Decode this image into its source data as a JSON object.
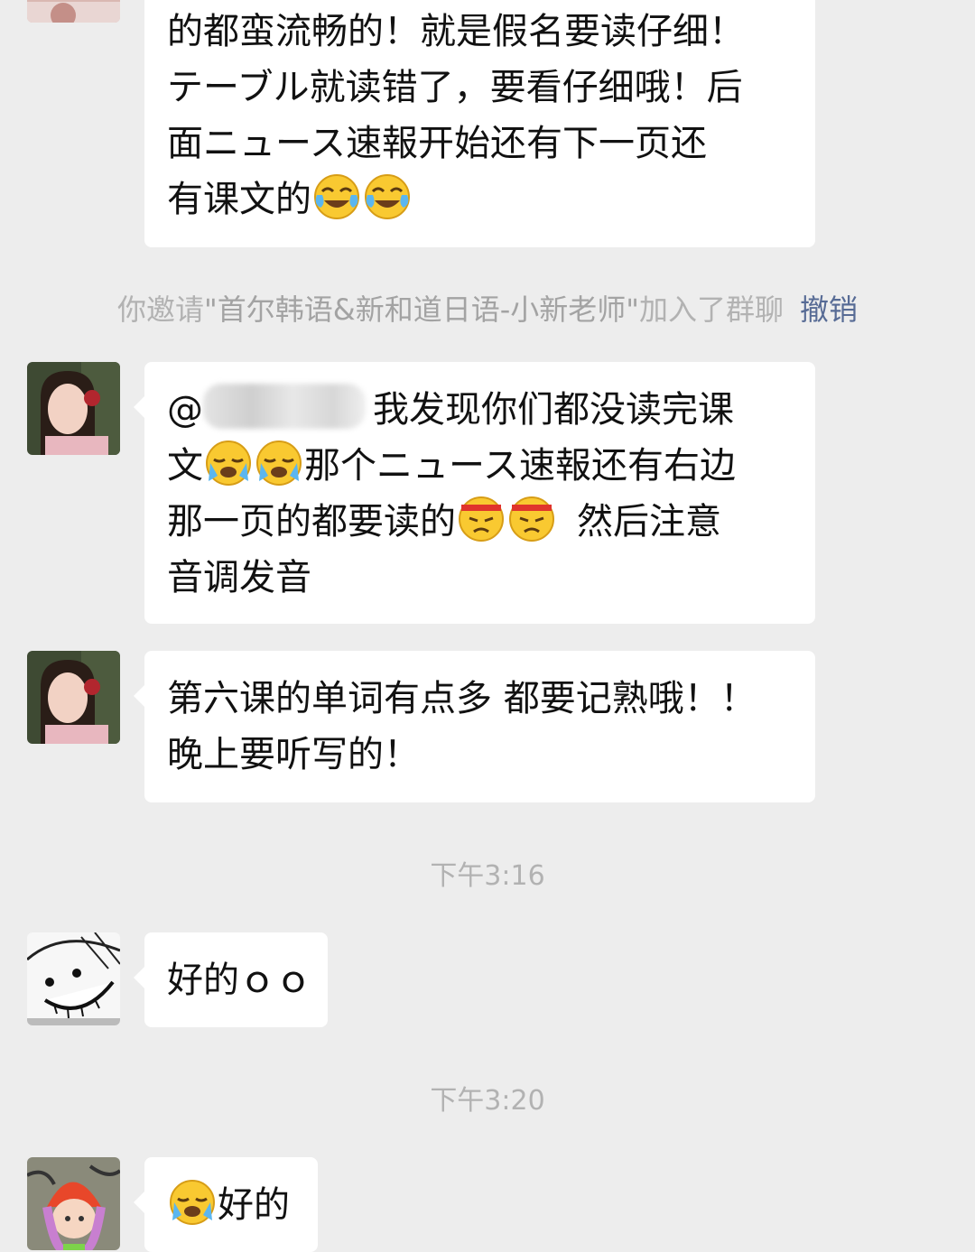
{
  "messages": {
    "m1": {
      "lines": [
        "的都蛮流畅的！就是假名要读仔细！",
        "テーブル就读错了，要看仔细哦！后",
        "面ニュース速報开始还有下一页还",
        "有课文的"
      ],
      "emoji": "tears-of-joy-emoji"
    },
    "system": {
      "prefix": "你邀请",
      "name": "\"首尔韩语&新和道日语-小新老师\"",
      "suffix": "加入了群聊",
      "action": "撤销"
    },
    "m2": {
      "at": "@",
      "line1": "我发现你们都没读完课",
      "line2a": "文",
      "line2b": "那个ニュース速報还有右边",
      "line3a": "那一页的都要读的",
      "line3b": "然后注意",
      "line4": "音调发音"
    },
    "m3": {
      "line1": "第六课的单词有点多  都要记熟哦！！",
      "line2": "晚上要听写的！"
    },
    "time1": "下午3:16",
    "m4": {
      "text": "好的ｏｏ"
    },
    "time2": "下午3:20",
    "m5": {
      "text": "好的"
    }
  },
  "colors": {
    "background": "#ededed",
    "bubble": "#ffffff",
    "link": "#576b95",
    "system_text": "#b2b2b2"
  }
}
